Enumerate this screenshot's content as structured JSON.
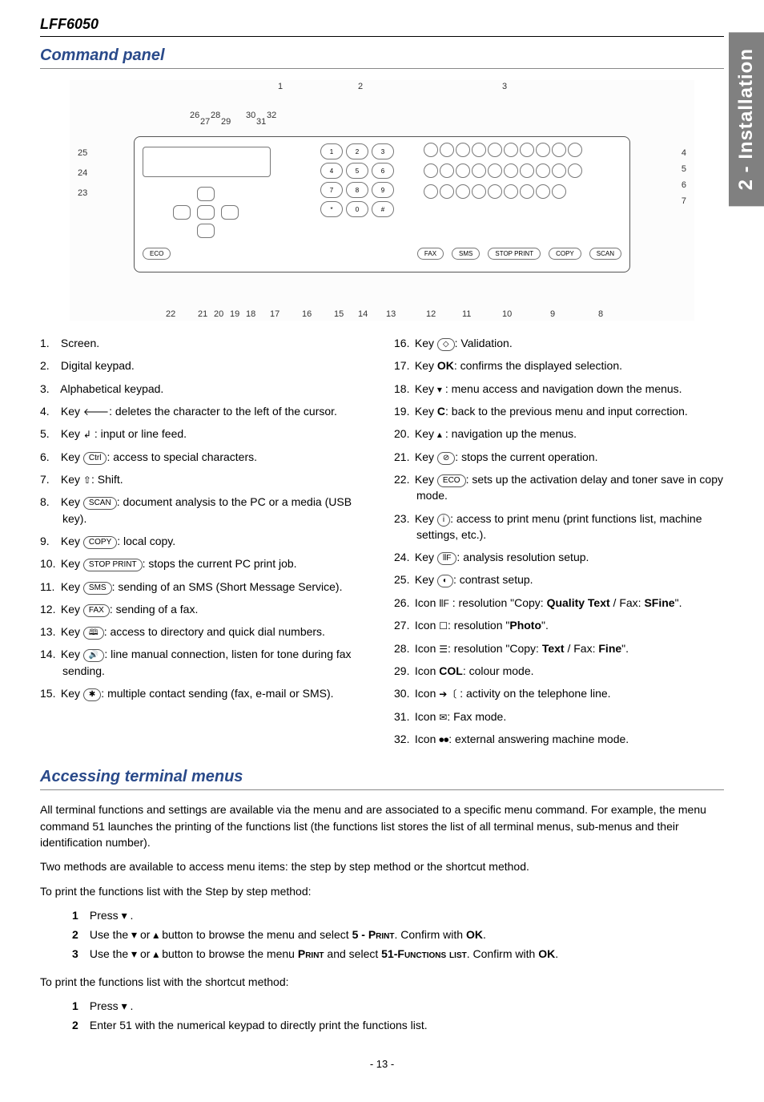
{
  "model": "LFF6050",
  "side_tab": "2 - Installation",
  "section1_title": "Command panel",
  "section2_title": "Accessing terminal menus",
  "page_number": "- 13 -",
  "diagram_callouts_top": [
    "1",
    "2",
    "3"
  ],
  "diagram_callouts_right": [
    "4",
    "5",
    "6",
    "7"
  ],
  "diagram_callouts_left": [
    "25",
    "24",
    "23"
  ],
  "diagram_callouts_bottom": [
    "22",
    "21",
    "20",
    "19",
    "18",
    "17",
    "16",
    "15",
    "14",
    "13",
    "12",
    "11",
    "10",
    "9",
    "8"
  ],
  "diagram_callouts_topleft": [
    "26",
    "27",
    "28",
    "29",
    "30",
    "31",
    "32"
  ],
  "panel_bottom_ovals": [
    "FAX",
    "SMS",
    "STOP PRINT",
    "COPY",
    "SCAN"
  ],
  "panel_misc": {
    "eco": "ECO",
    "ok": "OK",
    "c": "C"
  },
  "keys": [
    {
      "n": "1.",
      "pre": "",
      "cap": "",
      "post": "Screen."
    },
    {
      "n": "2.",
      "pre": "",
      "cap": "",
      "post": "Digital keypad."
    },
    {
      "n": "3.",
      "pre": "",
      "cap": "",
      "post": "Alphabetical keypad."
    },
    {
      "n": "4.",
      "pre": "Key ",
      "icon": "🡐",
      "post": ": deletes the character to the left of the cursor."
    },
    {
      "n": "5.",
      "pre": "Key ",
      "icon": "↲",
      "post": " : input or line feed."
    },
    {
      "n": "6.",
      "pre": "Key ",
      "cap": "Ctrl",
      "post": ": access to special characters."
    },
    {
      "n": "7.",
      "pre": "Key ",
      "icon": "⇧",
      "post": ": Shift."
    },
    {
      "n": "8.",
      "pre": "Key ",
      "cap": "SCAN",
      "post": ": document analysis to the PC or a media (USB key)."
    },
    {
      "n": "9.",
      "pre": "Key ",
      "cap": "COPY",
      "post": ": local copy."
    },
    {
      "n": "10.",
      "pre": "Key ",
      "cap": "STOP PRINT",
      "post": ": stops the current PC print job."
    },
    {
      "n": "11.",
      "pre": "Key ",
      "cap": "SMS",
      "post": ": sending of an SMS (Short Message Service)."
    },
    {
      "n": "12.",
      "pre": "Key ",
      "cap": "FAX",
      "post": ": sending of a fax."
    },
    {
      "n": "13.",
      "pre": "Key ",
      "cap": "🕮",
      "post": ": access to directory and quick dial numbers."
    },
    {
      "n": "14.",
      "pre": "Key ",
      "cap": "🔊",
      "post": ": line manual connection, listen for tone during fax sending."
    },
    {
      "n": "15.",
      "pre": "Key ",
      "cap": "✱",
      "post": ": multiple contact sending (fax, e-mail or SMS)."
    }
  ],
  "keys_right": [
    {
      "n": "16.",
      "pre": "Key ",
      "cap": "◇",
      "post": ": Validation."
    },
    {
      "n": "17.",
      "pre": "Key ",
      "bold": "OK",
      "post": ": confirms the displayed selection."
    },
    {
      "n": "18.",
      "pre": "Key ",
      "icon": "▾",
      "post": " : menu access and navigation down the menus."
    },
    {
      "n": "19.",
      "pre": "Key ",
      "bold": "C",
      "post": ": back to the previous menu and input correction."
    },
    {
      "n": "20.",
      "pre": "Key ",
      "icon": "▴",
      "post": " : navigation up the menus."
    },
    {
      "n": "21.",
      "pre": "Key ",
      "cap": "⊘",
      "post": ": stops the current operation."
    },
    {
      "n": "22.",
      "pre": "Key ",
      "cap": "ECO",
      "post": ": sets up the activation delay and toner save in copy mode."
    },
    {
      "n": "23.",
      "pre": "Key ",
      "cap": "i",
      "post": ": access to print menu (print functions list, machine settings, etc.)."
    },
    {
      "n": "24.",
      "pre": "Key ",
      "cap": "⦀F",
      "post": ": analysis resolution setup."
    },
    {
      "n": "25.",
      "pre": "Key ",
      "cap": "◐",
      "post": ": contrast setup."
    },
    {
      "n": "26.",
      "pre": "Icon ",
      "icon": "⦀F",
      "post_html": " : resolution \"Copy: <b>Quality Text</b> / Fax: <b>SFine</b>\"."
    },
    {
      "n": "27.",
      "pre": "Icon ",
      "icon": "☐",
      "post_html": ": resolution \"<b>Photo</b>\"."
    },
    {
      "n": "28.",
      "pre": "Icon ",
      "icon": "☰",
      "post_html": ": resolution \"Copy: <b>Text</b> / Fax: <b>Fine</b>\"."
    },
    {
      "n": "29.",
      "pre": "Icon ",
      "bold": "COL",
      "post": ": colour mode."
    },
    {
      "n": "30.",
      "pre": "Icon ",
      "icon": "➔〔",
      "post": " : activity on the telephone line."
    },
    {
      "n": "31.",
      "pre": "Icon ",
      "icon": "✉",
      "post": ": Fax mode."
    },
    {
      "n": "32.",
      "pre": "Icon ",
      "icon": "⏺⏺",
      "post": ": external answering machine mode."
    }
  ],
  "menus_intro": "All terminal functions and settings are available via the menu and are associated to a specific menu command. For example, the menu command 51 launches the printing of the functions list (the functions list stores the list of all terminal menus, sub-menus and their identification number).",
  "menus_two_methods": "Two methods are available to access menu items: the step by step method or the shortcut method.",
  "menus_step_intro": "To print the functions list with the Step by step method:",
  "steps_step": [
    {
      "n": "1",
      "html": "Press ▾ ."
    },
    {
      "n": "2",
      "html": "Use the ▾ or ▴ button to browse the menu and select <b>5 - <span class=\"smallcaps\">Print</span></b>. Confirm with <b>OK</b>."
    },
    {
      "n": "3",
      "html": "Use the ▾ or ▴ button to browse the menu <b><span class=\"smallcaps\">Print</span></b> and select <b>51-<span class=\"smallcaps\">Functions list</span></b>. Confirm with <b>OK</b>."
    }
  ],
  "menus_shortcut_intro": "To print the functions list with the shortcut method:",
  "steps_shortcut": [
    {
      "n": "1",
      "html": "Press ▾ ."
    },
    {
      "n": "2",
      "html": "Enter 51 with the numerical keypad to directly print the functions list."
    }
  ]
}
